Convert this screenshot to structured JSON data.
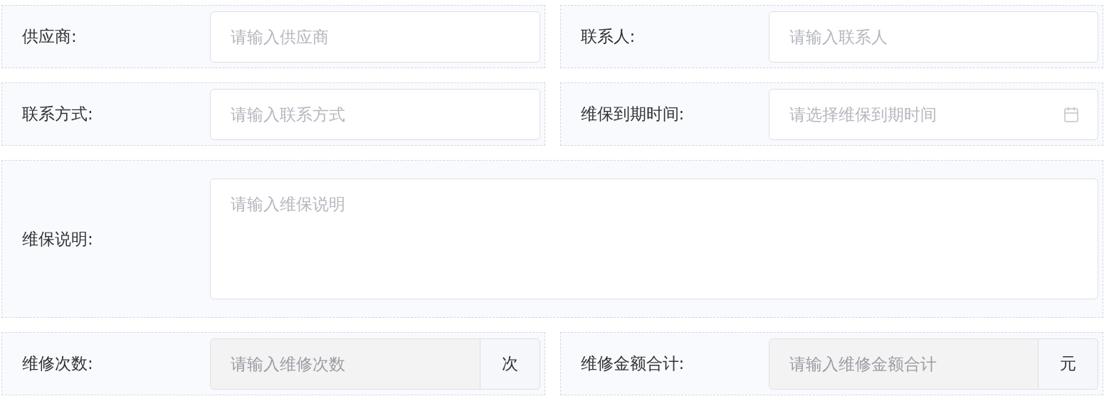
{
  "form": {
    "fields": [
      {
        "label": "供应商:",
        "kind": "text",
        "placeholder": "请输入供应商",
        "disabled": false
      },
      {
        "label": "联系人:",
        "kind": "text",
        "placeholder": "请输入联系人",
        "disabled": false
      },
      {
        "label": "联系方式:",
        "kind": "text",
        "placeholder": "请输入联系方式",
        "disabled": false
      },
      {
        "label": "维保到期时间:",
        "kind": "date",
        "placeholder": "请选择维保到期时间",
        "disabled": false
      },
      {
        "label": "维保说明:",
        "kind": "textarea",
        "placeholder": "请输入维保说明",
        "disabled": false
      },
      {
        "label": "维修次数:",
        "kind": "append",
        "placeholder": "请输入维修次数",
        "suffix": "次",
        "disabled": true
      },
      {
        "label": "维修金额合计:",
        "kind": "append",
        "placeholder": "请输入维修金额合计",
        "suffix": "元",
        "disabled": true
      }
    ]
  }
}
